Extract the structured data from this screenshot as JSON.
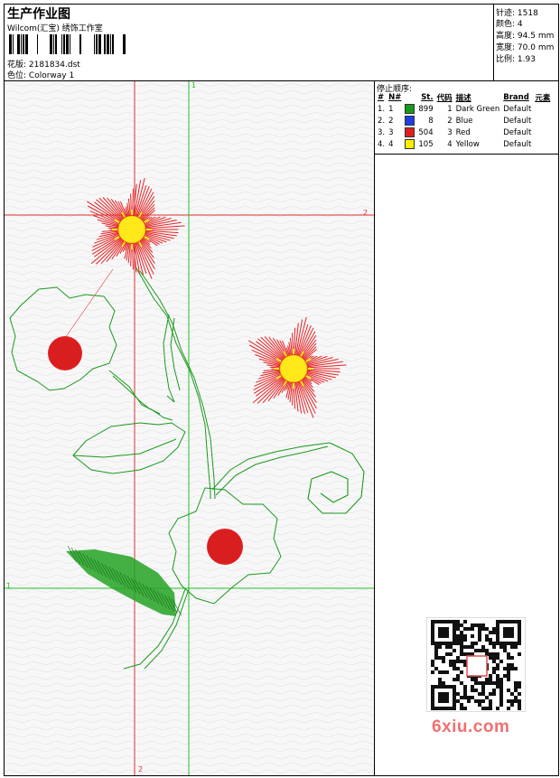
{
  "header": {
    "title": "生产作业图",
    "subtitle": "Wilcom(汇宝) 绣饰工作室",
    "design_label": "花版:",
    "design_value": "2181834.dst",
    "colorway_label": "色位:",
    "colorway_value": "Colorway 1"
  },
  "stats": {
    "stitches_label": "针迹:",
    "stitches_value": "1518",
    "colors_label": "颜色:",
    "colors_value": "4",
    "height_label": "高度:",
    "height_value": "94.5 mm",
    "width_label": "宽度:",
    "width_value": "70.0 mm",
    "ratio_label": "比例:",
    "ratio_value": "1.93"
  },
  "stop_sequence": {
    "title": "停止顺序:",
    "columns": [
      "#",
      "N#",
      "St.",
      "代码",
      "描述",
      "Brand",
      "元素"
    ],
    "rows": [
      {
        "idx": "1.",
        "n": "1",
        "color": "#1a9a1a",
        "st": "899",
        "code": "1",
        "desc": "Dark Green",
        "brand": "Default"
      },
      {
        "idx": "2.",
        "n": "2",
        "color": "#1f3fe0",
        "st": "8",
        "code": "2",
        "desc": "Blue",
        "brand": "Default"
      },
      {
        "idx": "3.",
        "n": "3",
        "color": "#e02020",
        "st": "504",
        "code": "3",
        "desc": "Red",
        "brand": "Default"
      },
      {
        "idx": "4.",
        "n": "4",
        "color": "#ffee00",
        "st": "105",
        "code": "4",
        "desc": "Yellow",
        "brand": "Default"
      }
    ]
  },
  "guides": {
    "red_v": "2",
    "red_h": "2",
    "green_v": "1",
    "green_h": "1"
  },
  "watermark": {
    "text": "6xiu.com"
  }
}
